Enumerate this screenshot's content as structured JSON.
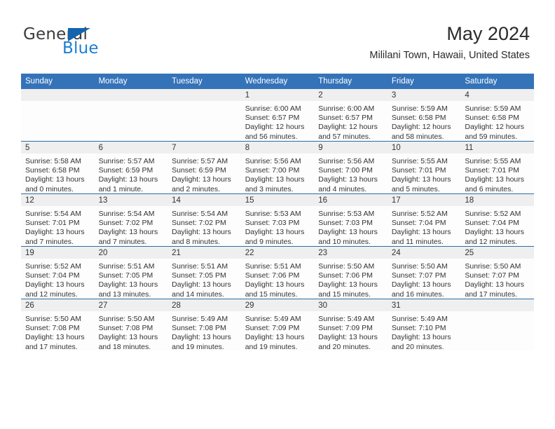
{
  "brand": {
    "name_top": "General",
    "name_bottom": "Blue",
    "triangle_icon": "triangle-icon",
    "color_dark": "#3c3c3c",
    "color_blue": "#1b7fd4"
  },
  "header": {
    "month_title": "May 2024",
    "location": "Mililani Town, Hawaii, United States"
  },
  "theme": {
    "header_blue": "#3573b9",
    "row_divider_blue": "#2e6da4",
    "daynum_band": "#efefef",
    "page_background": "#ffffff"
  },
  "calendar": {
    "weekday_headers": [
      "Sunday",
      "Monday",
      "Tuesday",
      "Wednesday",
      "Thursday",
      "Friday",
      "Saturday"
    ],
    "labels": {
      "sunrise": "Sunrise:",
      "sunset": "Sunset:",
      "daylight": "Daylight:"
    },
    "weeks": [
      [
        {
          "day": "",
          "empty": true
        },
        {
          "day": "",
          "empty": true
        },
        {
          "day": "",
          "empty": true
        },
        {
          "day": "1",
          "sunrise": "Sunrise: 6:00 AM",
          "sunset": "Sunset: 6:57 PM",
          "daylight": "Daylight: 12 hours and 56 minutes."
        },
        {
          "day": "2",
          "sunrise": "Sunrise: 6:00 AM",
          "sunset": "Sunset: 6:57 PM",
          "daylight": "Daylight: 12 hours and 57 minutes."
        },
        {
          "day": "3",
          "sunrise": "Sunrise: 5:59 AM",
          "sunset": "Sunset: 6:58 PM",
          "daylight": "Daylight: 12 hours and 58 minutes."
        },
        {
          "day": "4",
          "sunrise": "Sunrise: 5:59 AM",
          "sunset": "Sunset: 6:58 PM",
          "daylight": "Daylight: 12 hours and 59 minutes."
        }
      ],
      [
        {
          "day": "5",
          "sunrise": "Sunrise: 5:58 AM",
          "sunset": "Sunset: 6:58 PM",
          "daylight": "Daylight: 13 hours and 0 minutes."
        },
        {
          "day": "6",
          "sunrise": "Sunrise: 5:57 AM",
          "sunset": "Sunset: 6:59 PM",
          "daylight": "Daylight: 13 hours and 1 minute."
        },
        {
          "day": "7",
          "sunrise": "Sunrise: 5:57 AM",
          "sunset": "Sunset: 6:59 PM",
          "daylight": "Daylight: 13 hours and 2 minutes."
        },
        {
          "day": "8",
          "sunrise": "Sunrise: 5:56 AM",
          "sunset": "Sunset: 7:00 PM",
          "daylight": "Daylight: 13 hours and 3 minutes."
        },
        {
          "day": "9",
          "sunrise": "Sunrise: 5:56 AM",
          "sunset": "Sunset: 7:00 PM",
          "daylight": "Daylight: 13 hours and 4 minutes."
        },
        {
          "day": "10",
          "sunrise": "Sunrise: 5:55 AM",
          "sunset": "Sunset: 7:01 PM",
          "daylight": "Daylight: 13 hours and 5 minutes."
        },
        {
          "day": "11",
          "sunrise": "Sunrise: 5:55 AM",
          "sunset": "Sunset: 7:01 PM",
          "daylight": "Daylight: 13 hours and 6 minutes."
        }
      ],
      [
        {
          "day": "12",
          "sunrise": "Sunrise: 5:54 AM",
          "sunset": "Sunset: 7:01 PM",
          "daylight": "Daylight: 13 hours and 7 minutes."
        },
        {
          "day": "13",
          "sunrise": "Sunrise: 5:54 AM",
          "sunset": "Sunset: 7:02 PM",
          "daylight": "Daylight: 13 hours and 7 minutes."
        },
        {
          "day": "14",
          "sunrise": "Sunrise: 5:54 AM",
          "sunset": "Sunset: 7:02 PM",
          "daylight": "Daylight: 13 hours and 8 minutes."
        },
        {
          "day": "15",
          "sunrise": "Sunrise: 5:53 AM",
          "sunset": "Sunset: 7:03 PM",
          "daylight": "Daylight: 13 hours and 9 minutes."
        },
        {
          "day": "16",
          "sunrise": "Sunrise: 5:53 AM",
          "sunset": "Sunset: 7:03 PM",
          "daylight": "Daylight: 13 hours and 10 minutes."
        },
        {
          "day": "17",
          "sunrise": "Sunrise: 5:52 AM",
          "sunset": "Sunset: 7:04 PM",
          "daylight": "Daylight: 13 hours and 11 minutes."
        },
        {
          "day": "18",
          "sunrise": "Sunrise: 5:52 AM",
          "sunset": "Sunset: 7:04 PM",
          "daylight": "Daylight: 13 hours and 12 minutes."
        }
      ],
      [
        {
          "day": "19",
          "sunrise": "Sunrise: 5:52 AM",
          "sunset": "Sunset: 7:04 PM",
          "daylight": "Daylight: 13 hours and 12 minutes."
        },
        {
          "day": "20",
          "sunrise": "Sunrise: 5:51 AM",
          "sunset": "Sunset: 7:05 PM",
          "daylight": "Daylight: 13 hours and 13 minutes."
        },
        {
          "day": "21",
          "sunrise": "Sunrise: 5:51 AM",
          "sunset": "Sunset: 7:05 PM",
          "daylight": "Daylight: 13 hours and 14 minutes."
        },
        {
          "day": "22",
          "sunrise": "Sunrise: 5:51 AM",
          "sunset": "Sunset: 7:06 PM",
          "daylight": "Daylight: 13 hours and 15 minutes."
        },
        {
          "day": "23",
          "sunrise": "Sunrise: 5:50 AM",
          "sunset": "Sunset: 7:06 PM",
          "daylight": "Daylight: 13 hours and 15 minutes."
        },
        {
          "day": "24",
          "sunrise": "Sunrise: 5:50 AM",
          "sunset": "Sunset: 7:07 PM",
          "daylight": "Daylight: 13 hours and 16 minutes."
        },
        {
          "day": "25",
          "sunrise": "Sunrise: 5:50 AM",
          "sunset": "Sunset: 7:07 PM",
          "daylight": "Daylight: 13 hours and 17 minutes."
        }
      ],
      [
        {
          "day": "26",
          "sunrise": "Sunrise: 5:50 AM",
          "sunset": "Sunset: 7:08 PM",
          "daylight": "Daylight: 13 hours and 17 minutes."
        },
        {
          "day": "27",
          "sunrise": "Sunrise: 5:50 AM",
          "sunset": "Sunset: 7:08 PM",
          "daylight": "Daylight: 13 hours and 18 minutes."
        },
        {
          "day": "28",
          "sunrise": "Sunrise: 5:49 AM",
          "sunset": "Sunset: 7:08 PM",
          "daylight": "Daylight: 13 hours and 19 minutes."
        },
        {
          "day": "29",
          "sunrise": "Sunrise: 5:49 AM",
          "sunset": "Sunset: 7:09 PM",
          "daylight": "Daylight: 13 hours and 19 minutes."
        },
        {
          "day": "30",
          "sunrise": "Sunrise: 5:49 AM",
          "sunset": "Sunset: 7:09 PM",
          "daylight": "Daylight: 13 hours and 20 minutes."
        },
        {
          "day": "31",
          "sunrise": "Sunrise: 5:49 AM",
          "sunset": "Sunset: 7:10 PM",
          "daylight": "Daylight: 13 hours and 20 minutes."
        },
        {
          "day": "",
          "empty": true
        }
      ]
    ]
  }
}
